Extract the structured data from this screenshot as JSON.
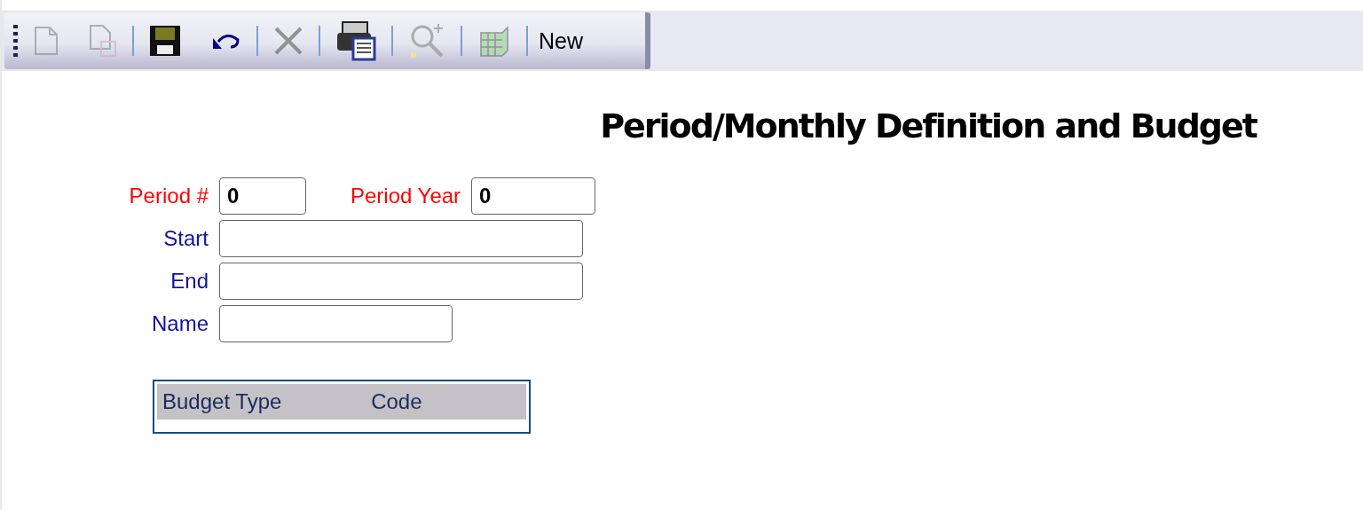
{
  "toolbar": {
    "items": [
      {
        "kind": "grip"
      },
      {
        "kind": "new-document",
        "disabled": true
      },
      {
        "kind": "copy-document",
        "disabled": true
      },
      {
        "kind": "separator"
      },
      {
        "kind": "save",
        "disabled": false
      },
      {
        "kind": "undo",
        "disabled": false
      },
      {
        "kind": "separator"
      },
      {
        "kind": "delete",
        "disabled": true
      },
      {
        "kind": "separator"
      },
      {
        "kind": "print",
        "disabled": false
      },
      {
        "kind": "separator"
      },
      {
        "kind": "zoom",
        "disabled": true
      },
      {
        "kind": "separator"
      },
      {
        "kind": "stack",
        "disabled": true
      },
      {
        "kind": "separator"
      },
      {
        "kind": "text",
        "label": "New"
      }
    ]
  },
  "title": "Period/Monthly Definition and Budget",
  "form": {
    "rows": [
      {
        "fields": [
          {
            "label": "Period #",
            "required": true,
            "value": "0"
          },
          {
            "label": "Period Year",
            "required": true,
            "value": "0"
          }
        ]
      },
      {
        "fields": [
          {
            "label": "Start",
            "required": false
          }
        ]
      },
      {
        "fields": [
          {
            "label": "End",
            "required": false
          }
        ]
      },
      {
        "fields": [
          {
            "label": "Name",
            "required": false
          }
        ]
      }
    ]
  },
  "table": {
    "columns": [
      "Budget Type",
      "Code"
    ]
  }
}
